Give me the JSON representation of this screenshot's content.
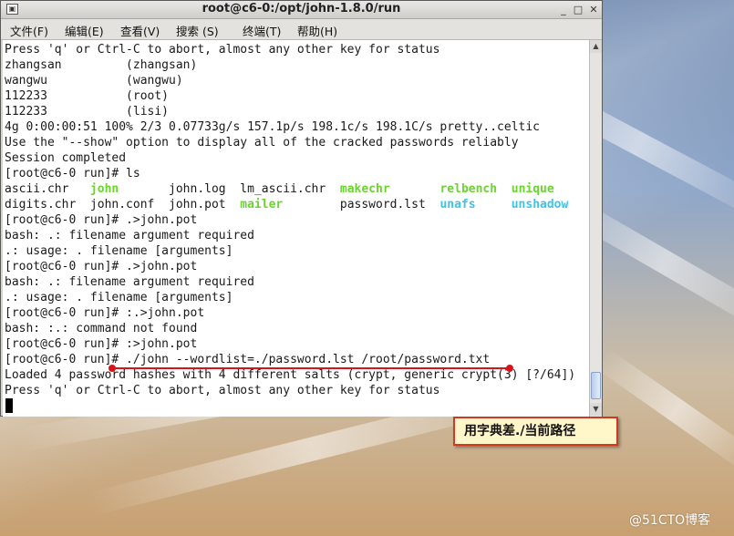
{
  "window": {
    "title": "root@c6-0:/opt/john-1.8.0/run",
    "minimize_glyph": "_",
    "maximize_glyph": "□",
    "close_glyph": "✕"
  },
  "menu": [
    {
      "label": "文件(F)"
    },
    {
      "label": "编辑(E)"
    },
    {
      "label": "查看(V)"
    },
    {
      "label": "搜索 (S)"
    },
    {
      "label": "终端(T)"
    },
    {
      "label": "帮助(H)"
    }
  ],
  "terminal": {
    "lines": [
      [
        {
          "t": "Press 'q' or Ctrl-C to abort, almost any other key for status"
        }
      ],
      [
        {
          "t": "zhangsan         (zhangsan)"
        }
      ],
      [
        {
          "t": "wangwu           (wangwu)"
        }
      ],
      [
        {
          "t": "112233           (root)"
        }
      ],
      [
        {
          "t": "112233           (lisi)"
        }
      ],
      [
        {
          "t": "4g 0:00:00:51 100% 2/3 0.07733g/s 157.1p/s 198.1c/s 198.1C/s pretty..celtic"
        }
      ],
      [
        {
          "t": "Use the \"--show\" option to display all of the cracked passwords reliably"
        }
      ],
      [
        {
          "t": "Session completed"
        }
      ],
      [
        {
          "t": "[root@c6-0 run]# ls"
        }
      ],
      [
        {
          "t": "ascii.chr   "
        },
        {
          "t": "john",
          "c": "g"
        },
        {
          "t": "       john.log  lm_ascii.chr  "
        },
        {
          "t": "makechr",
          "c": "g"
        },
        {
          "t": "       "
        },
        {
          "t": "relbench",
          "c": "g"
        },
        {
          "t": "  "
        },
        {
          "t": "unique",
          "c": "g"
        }
      ],
      [
        {
          "t": "digits.chr  john.conf  john.pot  "
        },
        {
          "t": "mailer",
          "c": "g"
        },
        {
          "t": "        password.lst  "
        },
        {
          "t": "unafs",
          "c": "c"
        },
        {
          "t": "     "
        },
        {
          "t": "unshadow",
          "c": "c"
        }
      ],
      [
        {
          "t": "[root@c6-0 run]# .>john.pot"
        }
      ],
      [
        {
          "t": "bash: .: filename argument required"
        }
      ],
      [
        {
          "t": ".: usage: . filename [arguments]"
        }
      ],
      [
        {
          "t": "[root@c6-0 run]# .>john.pot"
        }
      ],
      [
        {
          "t": "bash: .: filename argument required"
        }
      ],
      [
        {
          "t": ".: usage: . filename [arguments]"
        }
      ],
      [
        {
          "t": "[root@c6-0 run]# :.>john.pot"
        }
      ],
      [
        {
          "t": "bash: :.: command not found"
        }
      ],
      [
        {
          "t": "[root@c6-0 run]# :>john.pot"
        }
      ],
      [
        {
          "t": "[root@c6-0 run]# ./john --wordlist=./password.lst /root/password.txt"
        }
      ],
      [
        {
          "t": "Loaded 4 password hashes with 4 different salts (crypt, generic crypt(3) [?/64])"
        }
      ],
      [
        {
          "t": "Press 'q' or Ctrl-C to abort, almost any other key for status"
        }
      ]
    ]
  },
  "scrollbar": {
    "up_glyph": "▲",
    "down_glyph": "▼"
  },
  "annotation": {
    "callout_text": "用字典差./当前路径"
  },
  "watermark": "@51CTO博客",
  "colors": {
    "accent_red": "#d6141b",
    "ls_green": "#6ad52c",
    "ls_cyan": "#3fc3e8"
  }
}
